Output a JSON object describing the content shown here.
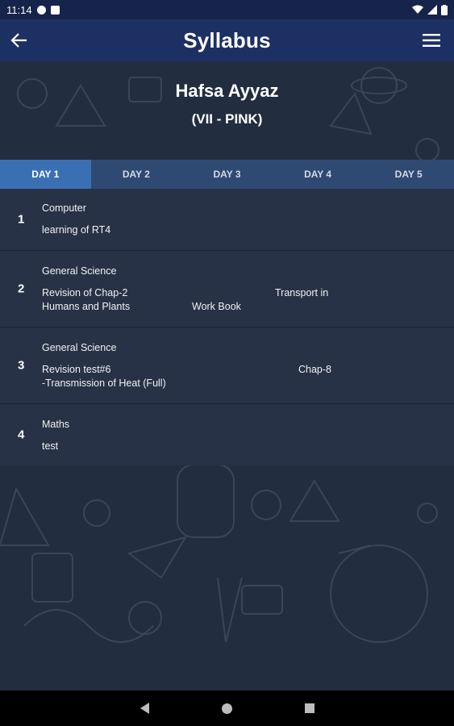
{
  "status": {
    "time": "11:14"
  },
  "header": {
    "title": "Syllabus"
  },
  "student": {
    "name": "Hafsa Ayyaz",
    "class": "(VII - PINK)"
  },
  "tabs": [
    "DAY 1",
    "DAY 2",
    "DAY 3",
    "DAY 4",
    "DAY 5"
  ],
  "syllabus": [
    {
      "number": "1",
      "subject": "Computer",
      "lines": [
        "learning of RT4"
      ]
    },
    {
      "number": "2",
      "subject": "General Science",
      "lines": [
        "Revision of Chap-2",
        "Transport in",
        "Humans and Plants",
        "Work Book"
      ]
    },
    {
      "number": "3",
      "subject": "General Science",
      "lines": [
        "Revision test#6",
        "Chap-8",
        "-Transmission of Heat (Full)"
      ]
    },
    {
      "number": "4",
      "subject": "Maths",
      "lines": [
        "test"
      ]
    }
  ]
}
